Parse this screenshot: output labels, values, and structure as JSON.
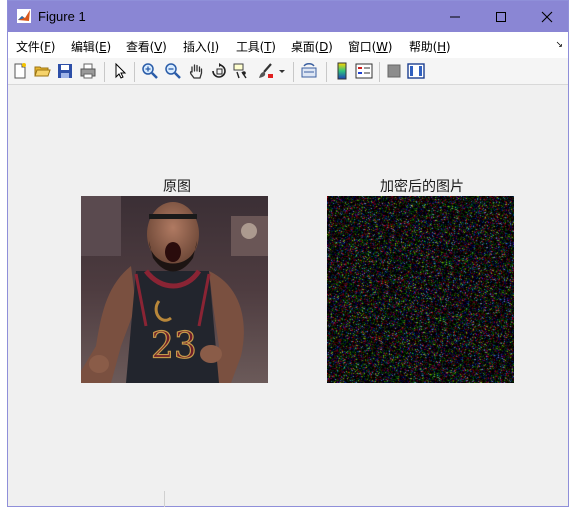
{
  "window": {
    "title": "Figure 1",
    "app_icon": "matlab-icon",
    "controls": [
      "minimize-icon",
      "maximize-icon",
      "close-icon"
    ]
  },
  "menubar": {
    "items": [
      {
        "label": "文件(",
        "key": "F",
        "end": ")"
      },
      {
        "label": "编辑(",
        "key": "E",
        "end": ")"
      },
      {
        "label": "查看(",
        "key": "V",
        "end": ")"
      },
      {
        "label": "插入(",
        "key": "I",
        "end": ")"
      },
      {
        "label": "工具(",
        "key": "T",
        "end": ")"
      },
      {
        "label": "桌面(",
        "key": "D",
        "end": ")"
      },
      {
        "label": "窗口(",
        "key": "W",
        "end": ")"
      },
      {
        "label": "帮助(",
        "key": "H",
        "end": ")"
      }
    ],
    "corner_icon": "dock-arrow-icon"
  },
  "toolbar": {
    "icons": [
      "new-figure-icon",
      "open-file-icon",
      "save-icon",
      "print-icon",
      "edit-plot-arrow-icon",
      "zoom-in-icon",
      "zoom-out-icon",
      "pan-hand-icon",
      "rotate-3d-icon",
      "data-cursor-icon",
      "brush-icon",
      "brush-dropdown-icon",
      "link-plot-icon",
      "insert-colorbar-icon",
      "insert-legend-icon",
      "hide-plot-tools-icon",
      "show-plot-tools-icon"
    ]
  },
  "figure": {
    "axes": [
      {
        "title": "原图",
        "content": "photo of basketball player in dark jersey number 23"
      },
      {
        "title": "加密后的图片",
        "content": "random colored pixel noise"
      }
    ]
  }
}
